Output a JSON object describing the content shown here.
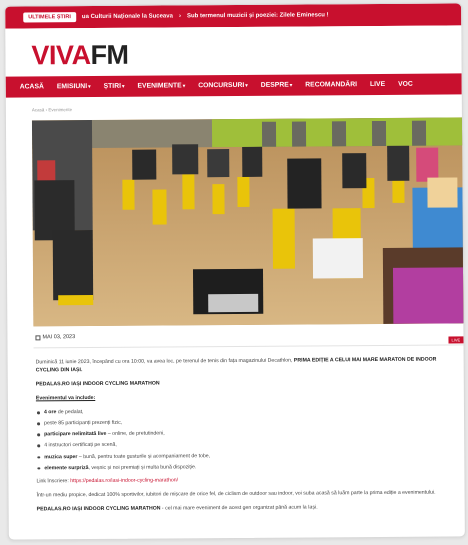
{
  "ticker": {
    "badge": "ULTIMELE ȘTIRI",
    "items": [
      "ua Culturii Naționale la Suceava",
      "Sub termenul muzicii și poeziei: Zilele Eminescu !"
    ],
    "separator": "›"
  },
  "logo": {
    "viva": "VIVA",
    "fm": "FM"
  },
  "nav": [
    {
      "label": "ACASĂ",
      "dropdown": false
    },
    {
      "label": "EMISIUNI",
      "dropdown": true
    },
    {
      "label": "ȘTIRI",
      "dropdown": true
    },
    {
      "label": "EVENIMENTE",
      "dropdown": true
    },
    {
      "label": "CONCURSURI",
      "dropdown": true
    },
    {
      "label": "DESPRE",
      "dropdown": true
    },
    {
      "label": "RECOMANDĂRI",
      "dropdown": false
    },
    {
      "label": "LIVE",
      "dropdown": false
    },
    {
      "label": "VOC",
      "dropdown": false
    }
  ],
  "breadcrumb": "Acasă › Evenimente",
  "meta": {
    "date": "MAI 03, 2023",
    "tag": "LIVE"
  },
  "article": {
    "intro_plain": "Duminică 11 iunie 2023, începând cu ora 10:00, va avea loc, pe terenul de tenis din fața magazinului Decathlon, ",
    "intro_bold": "PRIMA EDIȚIE A CELUI MAI MARE MARATON DE INDOOR CYCLING DIN IAȘI.",
    "title": "PEDALAS.RO IAȘI INDOOR CYCLING MARATHON",
    "includes_heading": "Evenimentul va include:",
    "bullets": [
      {
        "bold": "4 ore",
        "rest": " de pedalat,"
      },
      {
        "bold": "",
        "rest": "peste 85 participanți prezenți fizic,"
      },
      {
        "bold": "participare nelimitată live",
        "rest": " – online, de pretutindeni,"
      },
      {
        "bold": "",
        "rest": "4 instructori certificați pe scenă,"
      },
      {
        "bold": "muzica super",
        "rest": " – bună, pentru toate gusturile și acompaniament de tobe,"
      },
      {
        "bold": "elemente surpriză",
        "rest": ", veșnic și noi premiați și multa bună dispoziție."
      }
    ],
    "register_label": "Link înscriere: ",
    "register_link": "https://pedalas.ro/iasi-indoor-cycling-marathon/",
    "paragraph2": "Într-un mediu propice, dedicat 100% sportivilor, iubitori de mișcare de orice fel, de ciclism de outdoor sau indoor, voi suba acasă să luăm parte la prima ediție a evenimentului.",
    "closing_bold": "PEDALAS.RO IAȘI INDOOR CYCLING MARATHON",
    "closing_rest": " - cel mai mare eveniment de acest gen organizat până acum la Iași."
  },
  "colors": {
    "brand": "#c8102e"
  }
}
